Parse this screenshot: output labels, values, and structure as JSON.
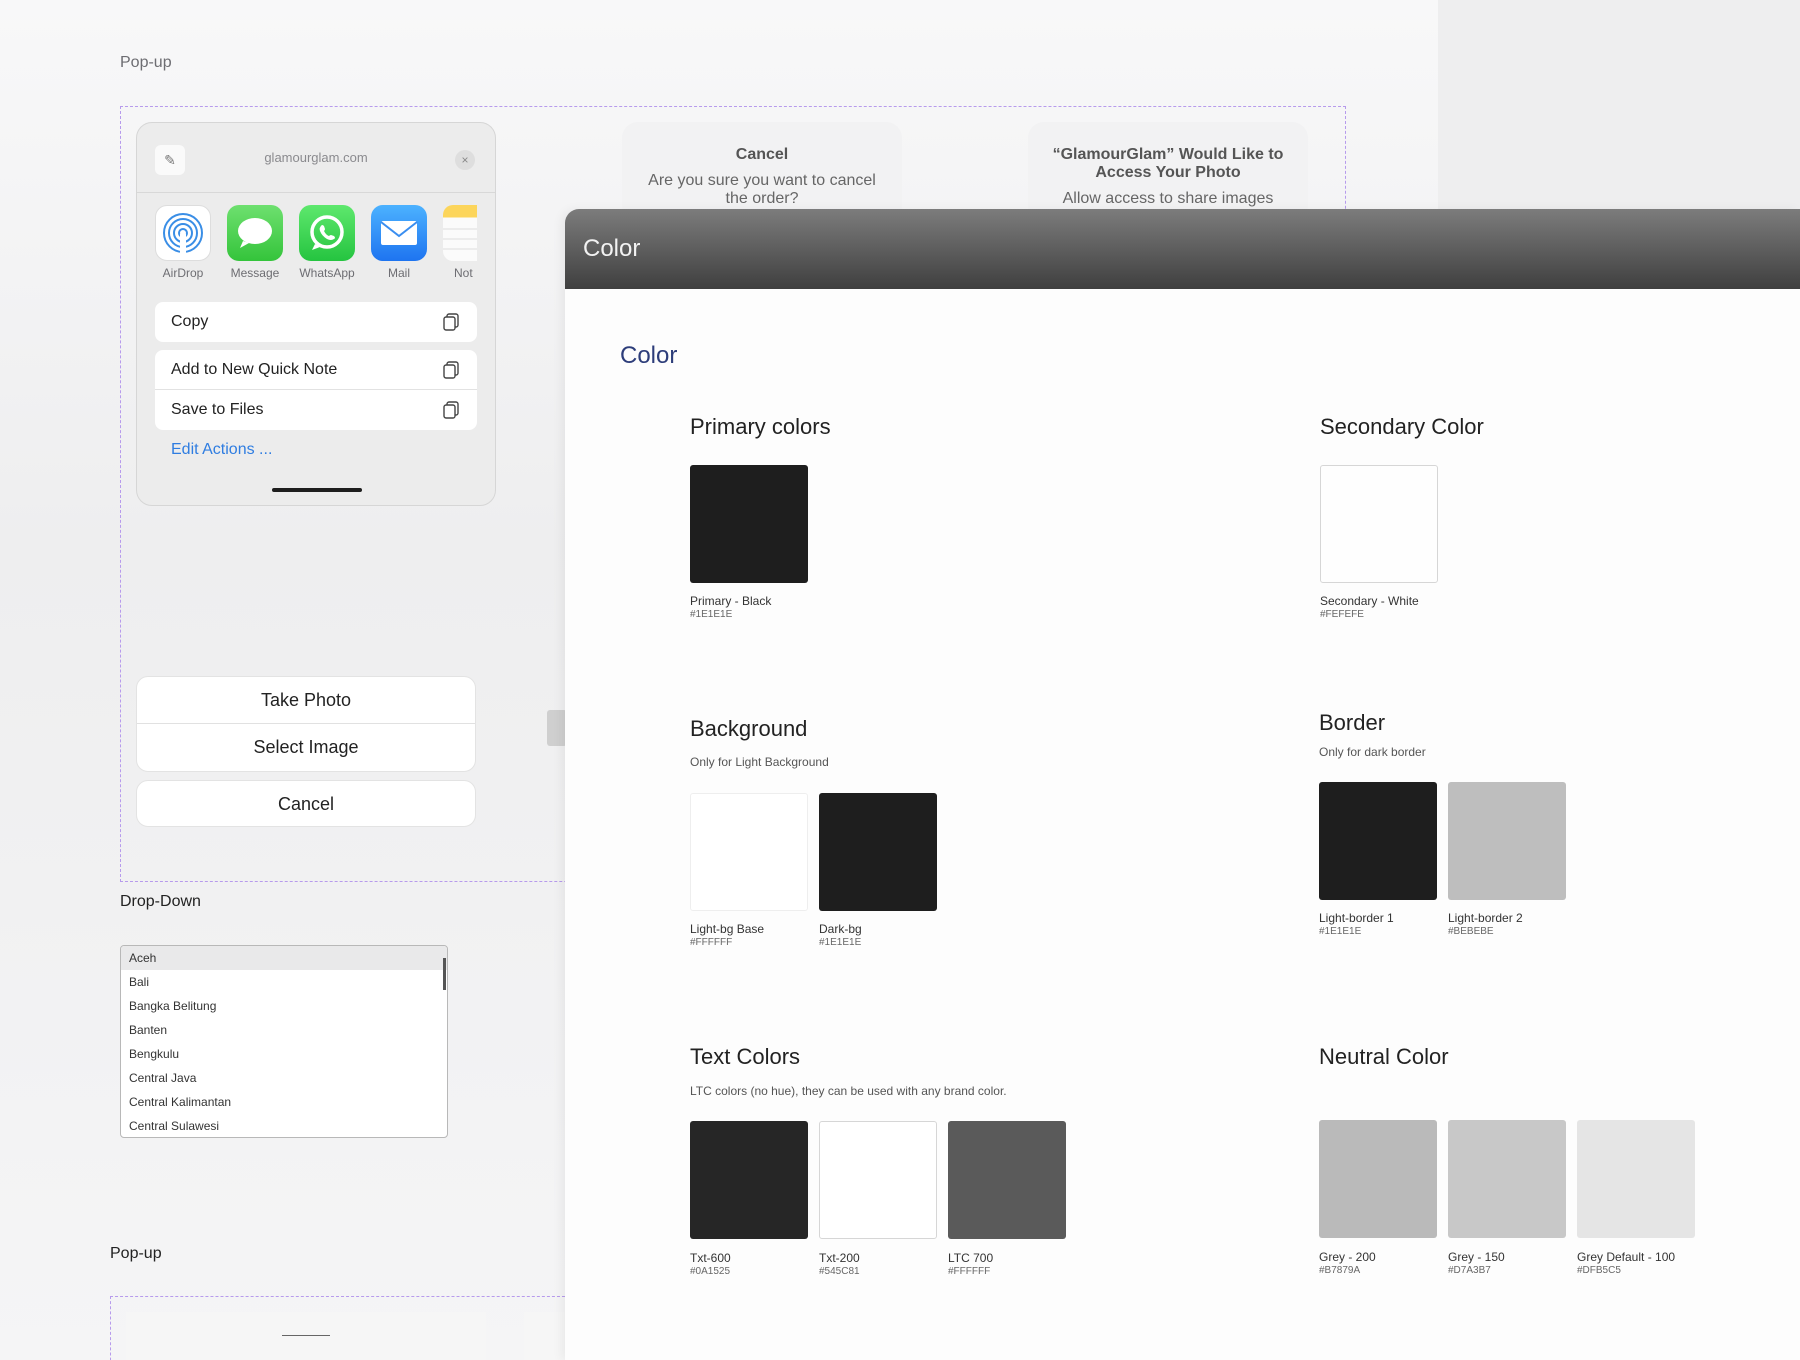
{
  "popup_top": {
    "label": "Pop-up",
    "share_sheet": {
      "url": "glamourglam.com",
      "apps": [
        {
          "label": "AirDrop",
          "icon": "airdrop-icon"
        },
        {
          "label": "Message",
          "icon": "message-icon"
        },
        {
          "label": "WhatsApp",
          "icon": "whatsapp-icon"
        },
        {
          "label": "Mail",
          "icon": "mail-icon"
        },
        {
          "label": "Not",
          "icon": "notes-icon"
        }
      ],
      "actions": [
        {
          "label": "Copy",
          "icon": "copy-icon"
        },
        {
          "label": "Add to New Quick Note",
          "icon": "copy-icon"
        },
        {
          "label": "Save to Files",
          "icon": "copy-icon"
        }
      ],
      "edit_actions": "Edit Actions ..."
    },
    "alert_cancel": {
      "title": "Cancel",
      "message": "Are you sure you want to cancel the order?"
    },
    "alert_access": {
      "title": "“GlamourGlam” Would Like to Access Your Photo",
      "message": "Allow access to share images"
    },
    "action_sheet": {
      "options": [
        "Take Photo",
        "Select Image"
      ],
      "cancel": "Cancel"
    }
  },
  "dropdown": {
    "label": "Drop-Down",
    "items": [
      "Aceh",
      "Bali",
      "Bangka Belitung",
      "Banten",
      "Bengkulu",
      "Central Java",
      "Central Kalimantan",
      "Central Sulawesi"
    ],
    "selected": "Aceh"
  },
  "popup_bottom": {
    "label": "Pop-up"
  },
  "color_window": {
    "window_title": "Color",
    "heading": "Color",
    "sections": {
      "primary": {
        "title": "Primary colors",
        "swatches": [
          {
            "name": "Primary - Black",
            "hex": "#1E1E1E",
            "color": "#1e1e1e"
          }
        ]
      },
      "secondary": {
        "title": "Secondary Color",
        "swatches": [
          {
            "name": "Secondary - White",
            "hex": "#FEFEFE",
            "color": "#fefefe"
          }
        ]
      },
      "background": {
        "title": "Background",
        "subtitle": "Only for Light Background",
        "swatches": [
          {
            "name": "Light-bg Base",
            "hex": "#FFFFFF",
            "color": "#ffffff"
          },
          {
            "name": "Dark-bg",
            "hex": "#1E1E1E",
            "color": "#1e1e1e"
          }
        ]
      },
      "border": {
        "title": "Border",
        "subtitle": "Only for dark border",
        "swatches": [
          {
            "name": "Light-border 1",
            "hex": "#1E1E1E",
            "color": "#1e1e1e"
          },
          {
            "name": "Light-border 2",
            "hex": "#BEBEBE",
            "color": "#bebebe"
          }
        ]
      },
      "text": {
        "title": "Text Colors",
        "subtitle": "LTC colors (no hue), they can be used with any brand color.",
        "swatches": [
          {
            "name": "Txt-600",
            "hex": "#0A1525",
            "color": "#262626"
          },
          {
            "name": "Txt-200",
            "hex": "#545C81",
            "color": "#ffffff"
          },
          {
            "name": "LTC 700",
            "hex": "#FFFFFF",
            "color": "#5a5a5a"
          }
        ]
      },
      "neutral": {
        "title": "Neutral Color",
        "swatches": [
          {
            "name": "Grey - 200",
            "hex": "#B7879A",
            "color": "#bababa"
          },
          {
            "name": "Grey - 150",
            "hex": "#D7A3B7",
            "color": "#c8c8c8"
          },
          {
            "name": "Grey Default - 100",
            "hex": "#DFB5C5",
            "color": "#e5e5e5"
          }
        ]
      }
    }
  }
}
